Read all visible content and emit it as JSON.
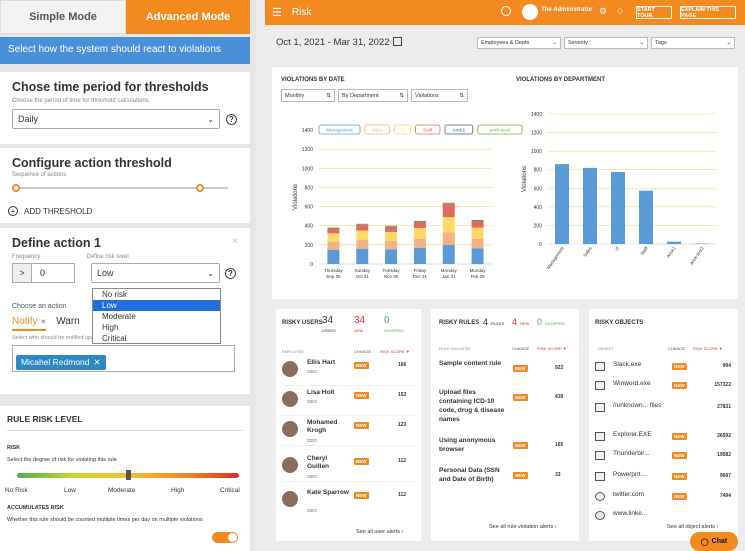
{
  "left": {
    "modes": {
      "simple": "Simple Mode",
      "advanced": "Advanced Mode"
    },
    "banner": "Select how the system should react to violations",
    "period": {
      "title": "Chose time period for thresholds",
      "sublabel": "Choose the period of time for threshold calculations",
      "value": "Daily"
    },
    "threshold": {
      "title": "Configure action threshold",
      "sublabel": "Sequence of actions",
      "add_label": "ADD THRESHOLD"
    },
    "action": {
      "title": "Define action 1",
      "freq_label": "Frequency",
      "freq_op": ">",
      "freq_value": "0",
      "risk_label": "Define risk level",
      "risk_value": "Low",
      "risk_options": [
        "No risk",
        "Low",
        "Moderate",
        "High",
        "Critical"
      ],
      "choose_label": "Choose an action",
      "actions": [
        "Notify",
        "Warn"
      ],
      "notify_label": "Select who should be notified upon violation of this policy",
      "recipient": "Micahel Redmond"
    },
    "rule_risk": {
      "title": "RULE RISK LEVEL",
      "risk_label": "RISK",
      "risk_desc": "Select the degree of risk for violating this rule",
      "scale": [
        "No Risk",
        "Low",
        "Moderate",
        "High",
        "Critical"
      ],
      "selected_level": "Moderate",
      "accum_label": "ACCUMULATES RISK",
      "accum_desc": "Whether this rule should be counted multiple times per day on multiple violations"
    }
  },
  "header": {
    "title": "Risk",
    "user": "The Administrator",
    "tour_btn": "START TOUR",
    "explain_btn": "EXPLAIN THIS PAGE"
  },
  "filters": {
    "date_range": "Oct 1, 2021 - Mar 31, 2022",
    "employees": "Employees & Depts",
    "severity": "Severity",
    "tags": "Tags"
  },
  "violations_by_date": {
    "title": "VIOLATIONS BY DATE",
    "controls": [
      "Monthly",
      "By Department",
      "Violations"
    ]
  },
  "violations_by_dept": {
    "title": "VIOLATIONS BY DEPARTMENT"
  },
  "chart_data": [
    {
      "type": "bar",
      "stacked": true,
      "ylabel": "Violations",
      "ylim": [
        0,
        1400
      ],
      "yticks": [
        0,
        200,
        400,
        600,
        800,
        1000,
        1200,
        1400
      ],
      "categories": [
        "Thursday Sep 30",
        "Sunday Oct 31",
        "Tuesday Nov 30",
        "Friday Dec 31",
        "Monday Jan 31",
        "Monday Feb 28"
      ],
      "category_lines": [
        [
          "Thursday",
          "Sep 30"
        ],
        [
          "Sunday",
          "Oct 31"
        ],
        [
          "Tuesday",
          "Nov 30"
        ],
        [
          "Friday",
          "Dec 31"
        ],
        [
          "Monday",
          "Jan 31"
        ],
        [
          "Monday",
          "Feb 28"
        ]
      ],
      "series": [
        {
          "name": "Management",
          "color": "#5b9bd5",
          "values": [
            150,
            160,
            155,
            170,
            200,
            165
          ]
        },
        {
          "name": "Sales",
          "color": "#f4b183",
          "values": [
            80,
            90,
            85,
            95,
            130,
            100
          ]
        },
        {
          "name": "IT",
          "color": "#ffd966",
          "values": [
            90,
            100,
            95,
            110,
            160,
            115
          ]
        },
        {
          "name": "Staff",
          "color": "#e06c5b",
          "values": [
            50,
            60,
            55,
            65,
            140,
            70
          ]
        },
        {
          "name": "Arick1",
          "color": "#3e5f8a",
          "values": [
            5,
            5,
            5,
            5,
            5,
            5
          ]
        },
        {
          "name": "arick-test2",
          "color": "#70ad47",
          "values": [
            5,
            5,
            5,
            5,
            5,
            5
          ]
        }
      ],
      "legend_position": "top"
    },
    {
      "type": "bar",
      "ylabel": "Violations",
      "ylim": [
        0,
        1400
      ],
      "yticks": [
        0,
        200,
        400,
        600,
        800,
        1000,
        1200,
        1400
      ],
      "categories": [
        "Management",
        "Sales",
        "IT",
        "Staff",
        "Arick1",
        "arick-test2"
      ],
      "values": [
        860,
        820,
        775,
        575,
        25,
        5
      ],
      "color": "#5b9bd5"
    }
  ],
  "risky_users": {
    "title": "RISKY USERS",
    "users_count": "34",
    "users_label": "USERS",
    "new_count": "34",
    "new_label": "NEW",
    "dropped_count": "0",
    "dropped_label": "DROPPED",
    "col_employee": "EMPLOYEE",
    "col_change": "CHANGE",
    "col_score": "RISK SCORE ▼",
    "rows": [
      {
        "name": "Ellis Hart",
        "role": "CEO",
        "change": "NEW",
        "score": "166"
      },
      {
        "name": "Lisa Holt",
        "role": "CEO",
        "change": "NEW",
        "score": "153"
      },
      {
        "name": "Mohamed Krogh",
        "role": "CEO",
        "change": "NEW",
        "score": "123"
      },
      {
        "name": "Cheryl Guillen",
        "role": "CEO",
        "change": "NEW",
        "score": "112"
      },
      {
        "name": "Kate Sparrow",
        "role": "CEO",
        "change": "NEW",
        "score": "112"
      }
    ],
    "footer": "See all user alerts"
  },
  "risky_rules": {
    "title": "RISKY RULES",
    "rules_count": "4",
    "rules_label": "RULES",
    "new_count": "4",
    "new_label": "NEW",
    "dropped_count": "0",
    "dropped_label": "DROPPED",
    "col_rule": "RULE VIOLATED",
    "col_change": "CHANGE",
    "col_score": "RISK SCORE ▼",
    "rows": [
      {
        "name": "Sample content rule",
        "change": "NEW",
        "score": "922"
      },
      {
        "name": "Upload files containing ICD-10 code, drug & disease names",
        "change": "NEW",
        "score": "439"
      },
      {
        "name": "Using anonymous browser",
        "change": "NEW",
        "score": "165"
      },
      {
        "name": "Personal Data (SSN and Date of Birth)",
        "change": "NEW",
        "score": "33"
      }
    ],
    "footer": "See all rule violation alerts"
  },
  "risky_objects": {
    "title": "RISKY OBJECTS",
    "col_object": "OBJECT",
    "col_change": "CHANGE",
    "col_score": "RISK SCORE ▼",
    "rows": [
      {
        "name": "Slack.exe",
        "change": "NEW",
        "score": "994"
      },
      {
        "name": "Winword.exe",
        "change": "NEW",
        "score": "157322"
      },
      {
        "name": "//unknown... files",
        "change": "",
        "score": "27831"
      },
      {
        "name": "Explorer.EXE",
        "change": "NEW",
        "score": "26592"
      },
      {
        "name": "Thunderbir...",
        "change": "NEW",
        "score": "19582"
      },
      {
        "name": "Powerpnt....",
        "change": "NEW",
        "score": "9687"
      },
      {
        "name": "twitter.com",
        "change": "NEW",
        "score": "7494"
      },
      {
        "name": "www.linke...",
        "change": "",
        "score": ""
      }
    ],
    "footer": "See all object alerts"
  },
  "chat": {
    "label": "Chat"
  }
}
